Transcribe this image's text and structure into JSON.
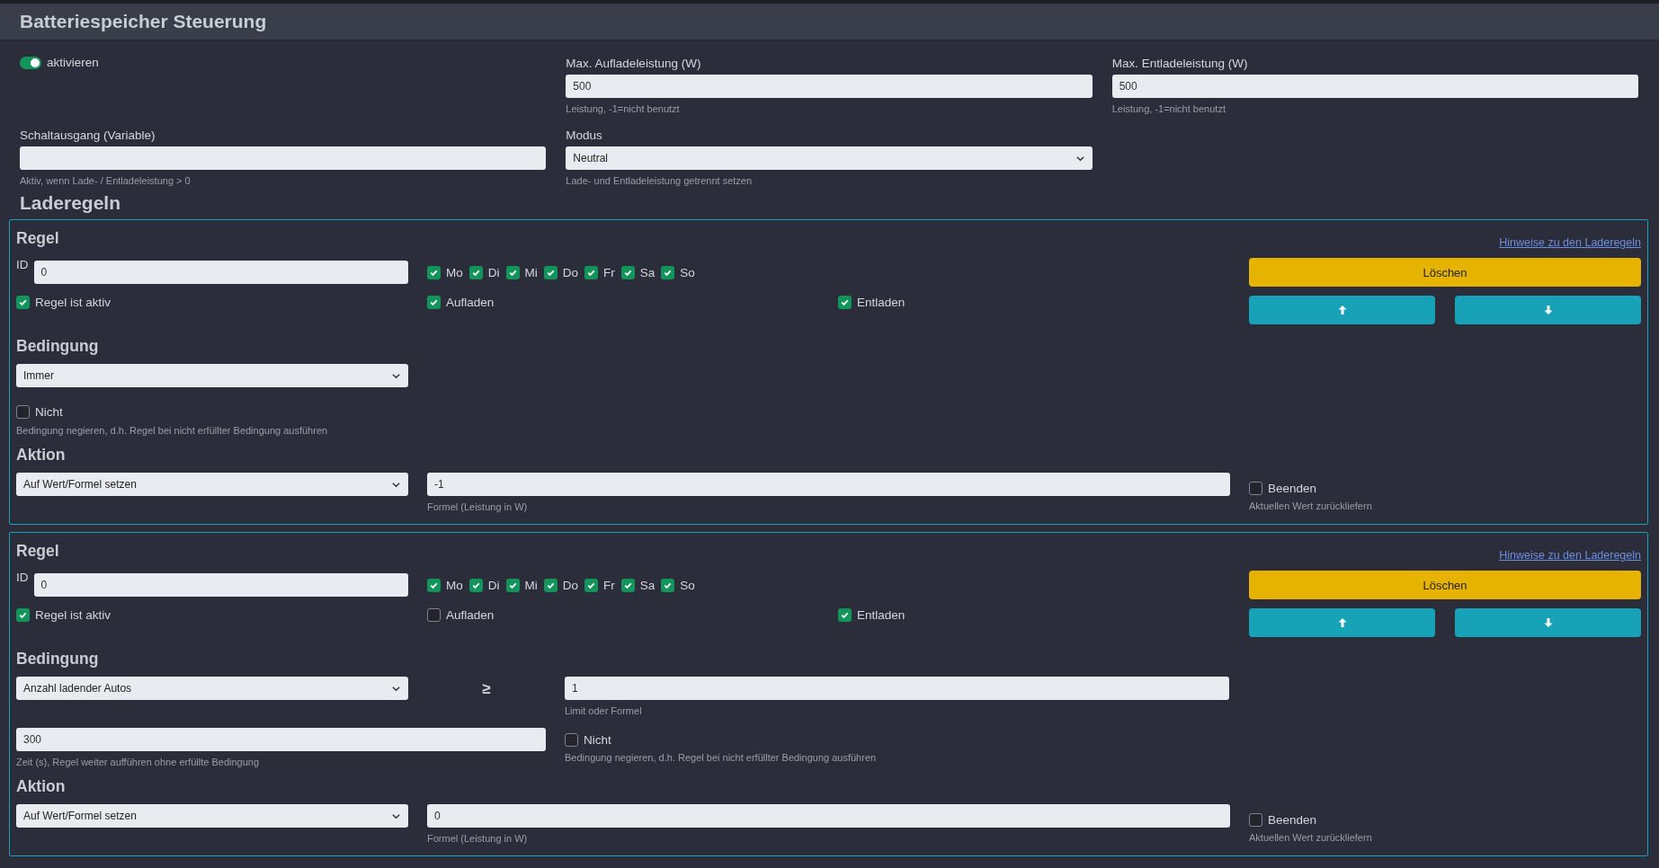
{
  "header": {
    "title": "Batteriespeicher Steuerung"
  },
  "enable": {
    "label": "aktivieren",
    "on": true
  },
  "max_charge": {
    "label": "Max. Aufladeleistung (W)",
    "value": "500",
    "hint": "Leistung, -1=nicht benutzt"
  },
  "max_discharge": {
    "label": "Max. Entladeleistung (W)",
    "value": "500",
    "hint": "Leistung, -1=nicht benutzt"
  },
  "switch_output": {
    "label": "Schaltausgang (Variable)",
    "hint": "Aktiv, wenn Lade- / Entladeleistung > 0"
  },
  "mode": {
    "label": "Modus",
    "value": "Neutral",
    "hint": "Lade- und Entladeleistung getrennt setzen"
  },
  "rules_heading": "Laderegeln",
  "rules": [
    {
      "title": "Regel",
      "help_link": "Hinweise zu den Laderegeln",
      "id_label": "ID",
      "id": "0",
      "days": [
        {
          "label": "Mo",
          "checked": true
        },
        {
          "label": "Di",
          "checked": true
        },
        {
          "label": "Mi",
          "checked": true
        },
        {
          "label": "Do",
          "checked": true
        },
        {
          "label": "Fr",
          "checked": true
        },
        {
          "label": "Sa",
          "checked": true
        },
        {
          "label": "So",
          "checked": true
        }
      ],
      "active": {
        "label": "Regel ist aktiv",
        "checked": true
      },
      "charge": {
        "label": "Aufladen",
        "checked": true
      },
      "discharge": {
        "label": "Entladen",
        "checked": true
      },
      "delete_button": "Löschen",
      "condition_heading": "Bedingung",
      "condition": {
        "kind": "simple",
        "value": "Immer",
        "negate": {
          "label": "Nicht",
          "checked": false,
          "hint": "Bedingung negieren, d.h. Regel bei nicht erfüllter Bedingung ausführen"
        }
      },
      "action_heading": "Aktion",
      "action": {
        "value": "Auf Wert/Formel setzen",
        "formula": "-1",
        "formula_hint": "Formel (Leistung in W)",
        "stop": {
          "label": "Beenden",
          "checked": false,
          "hint": "Aktuellen Wert zurückliefern"
        }
      }
    },
    {
      "title": "Regel",
      "help_link": "Hinweise zu den Laderegeln",
      "id_label": "ID",
      "id": "0",
      "days": [
        {
          "label": "Mo",
          "checked": true
        },
        {
          "label": "Di",
          "checked": true
        },
        {
          "label": "Mi",
          "checked": true
        },
        {
          "label": "Do",
          "checked": true
        },
        {
          "label": "Fr",
          "checked": true
        },
        {
          "label": "Sa",
          "checked": true
        },
        {
          "label": "So",
          "checked": true
        }
      ],
      "active": {
        "label": "Regel ist aktiv",
        "checked": true
      },
      "charge": {
        "label": "Aufladen",
        "checked": false
      },
      "discharge": {
        "label": "Entladen",
        "checked": true
      },
      "delete_button": "Löschen",
      "condition_heading": "Bedingung",
      "condition": {
        "kind": "compare",
        "value": "Anzahl ladender Autos",
        "operator": "≥",
        "limit": "1",
        "limit_hint": "Limit oder Formel",
        "duration": "300",
        "duration_hint": "Zeit (s), Regel weiter aufführen ohne erfüllte Bedingung",
        "negate": {
          "label": "Nicht",
          "checked": false,
          "hint": "Bedingung negieren, d.h. Regel bei nicht erfüllter Bedingung ausführen"
        }
      },
      "action_heading": "Aktion",
      "action": {
        "value": "Auf Wert/Formel setzen",
        "formula": "0",
        "formula_hint": "Formel (Leistung in W)",
        "stop": {
          "label": "Beenden",
          "checked": false,
          "hint": "Aktuellen Wert zurückliefern"
        }
      }
    }
  ]
}
